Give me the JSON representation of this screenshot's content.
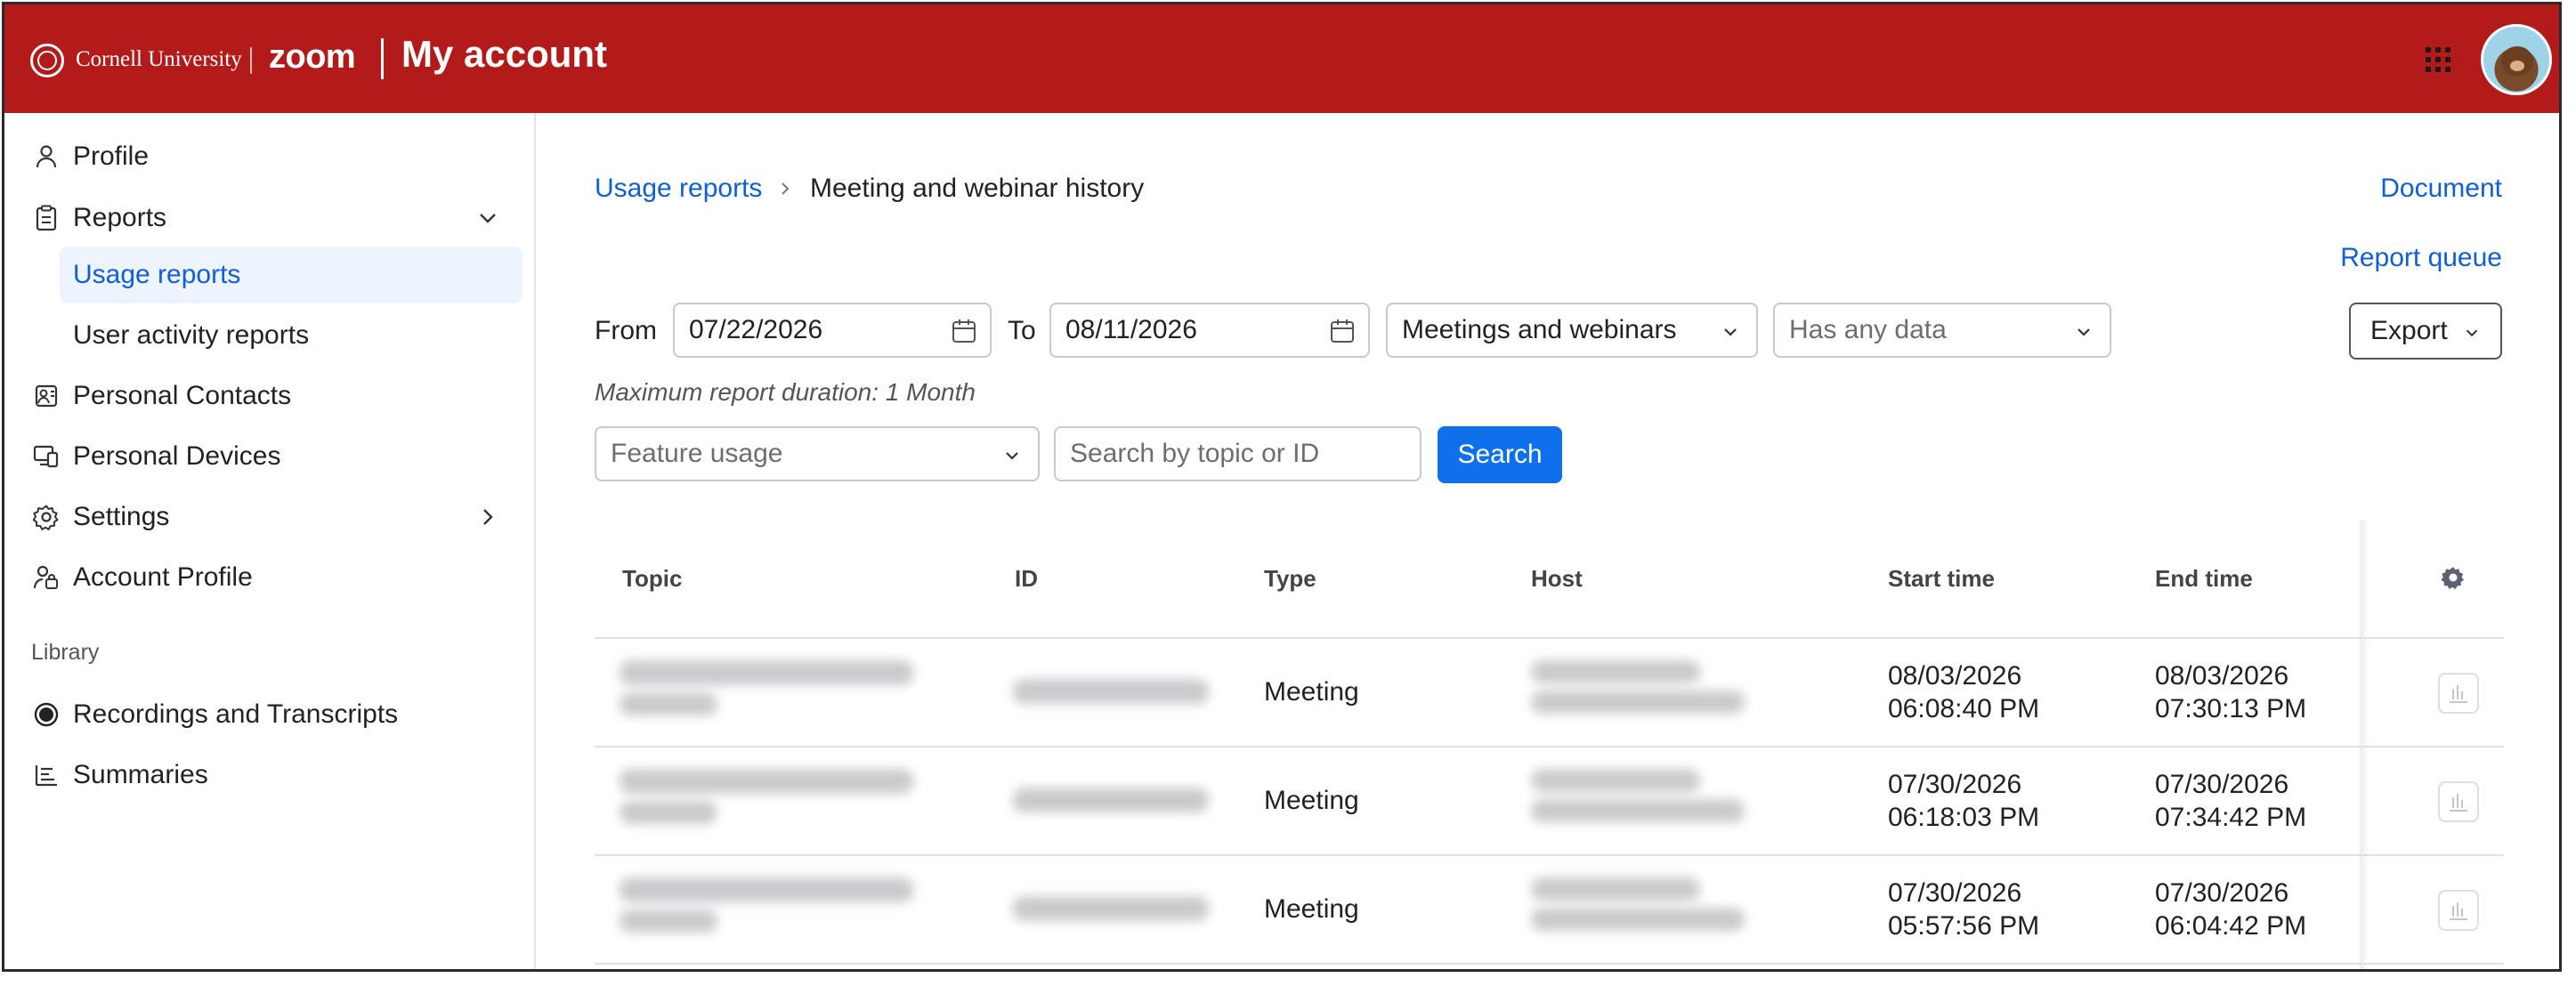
{
  "header": {
    "university": "Cornell University",
    "brand": "zoom",
    "title": "My account",
    "brand_color": "#b31b1b"
  },
  "sidebar": {
    "items": [
      {
        "label": "Profile",
        "icon": "person-icon"
      },
      {
        "label": "Reports",
        "icon": "clipboard-icon",
        "expanded": true
      },
      {
        "label": "Usage reports",
        "active": true
      },
      {
        "label": "User activity reports"
      },
      {
        "label": "Personal Contacts",
        "icon": "contacts-icon"
      },
      {
        "label": "Personal Devices",
        "icon": "devices-icon"
      },
      {
        "label": "Settings",
        "icon": "gear-icon"
      },
      {
        "label": "Account Profile",
        "icon": "account-profile-icon"
      }
    ],
    "library_header": "Library",
    "library_items": [
      {
        "label": "Recordings and Transcripts",
        "icon": "record-icon"
      },
      {
        "label": "Summaries",
        "icon": "summary-list-icon"
      }
    ]
  },
  "breadcrumb": {
    "parent": "Usage reports",
    "current": "Meeting and webinar history"
  },
  "links": {
    "document": "Document",
    "report_queue": "Report queue"
  },
  "filters": {
    "from_label": "From",
    "from_value": "07/22/2026",
    "to_label": "To",
    "to_value": "08/11/2026",
    "type_value": "Meetings and webinars",
    "data_placeholder": "Has any data",
    "hint": "Maximum report duration: 1 Month",
    "feature_placeholder": "Feature usage",
    "search_placeholder": "Search by topic or ID",
    "search_button": "Search",
    "export_button": "Export"
  },
  "table": {
    "columns": [
      "Topic",
      "ID",
      "Type",
      "Host",
      "Start time",
      "End time"
    ],
    "rows": [
      {
        "type": "Meeting",
        "start_date": "08/03/2026",
        "start_time": "06:08:40 PM",
        "end_date": "08/03/2026",
        "end_time": "07:30:13 PM"
      },
      {
        "type": "Meeting",
        "start_date": "07/30/2026",
        "start_time": "06:18:03 PM",
        "end_date": "07/30/2026",
        "end_time": "07:34:42 PM"
      },
      {
        "type": "Meeting",
        "start_date": "07/30/2026",
        "start_time": "05:57:56 PM",
        "end_date": "07/30/2026",
        "end_time": "06:04:42 PM"
      }
    ]
  },
  "colors": {
    "accent": "#0e71eb",
    "link": "#0e5fd8",
    "active_bg": "#eef4fd"
  }
}
